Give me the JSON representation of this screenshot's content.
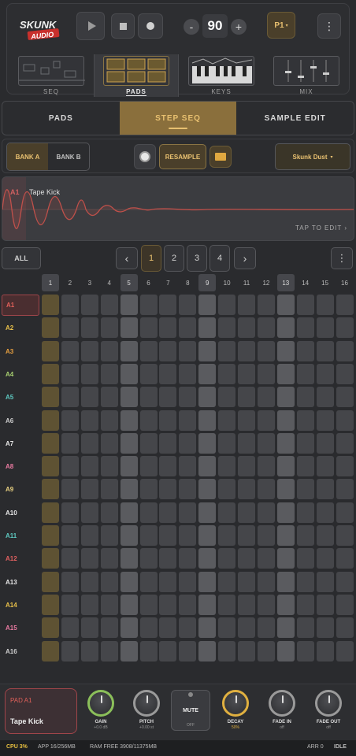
{
  "header": {
    "logo_text": "SKUNK AUDIO",
    "tempo": "90",
    "tempo_minus": "-",
    "tempo_plus": "+",
    "pattern": "P1",
    "modes": [
      {
        "label": "SEQ"
      },
      {
        "label": "PADS"
      },
      {
        "label": "KEYS"
      },
      {
        "label": "MIX"
      }
    ],
    "active_mode": "PADS"
  },
  "tabs": [
    {
      "label": "PADS"
    },
    {
      "label": "STEP SEQ"
    },
    {
      "label": "SAMPLE EDIT"
    }
  ],
  "active_tab": "STEP SEQ",
  "bank": {
    "a": "BANK A",
    "b": "BANK B",
    "resample": "RESAMPLE",
    "kit": "Skunk Dust"
  },
  "waveform": {
    "pad": "A1",
    "sample": "Tape Kick",
    "hint": "TAP TO EDIT ›"
  },
  "nav": {
    "all": "ALL",
    "prev": "‹",
    "next": "›",
    "pages": [
      "1",
      "2",
      "3",
      "4"
    ],
    "active_page": "1",
    "more": "⋮"
  },
  "grid": {
    "steps": [
      "1",
      "2",
      "3",
      "4",
      "5",
      "6",
      "7",
      "8",
      "9",
      "10",
      "11",
      "12",
      "13",
      "14",
      "15",
      "16"
    ],
    "rows": [
      {
        "label": "A1",
        "color": "#e0605a"
      },
      {
        "label": "A2",
        "color": "#e8c04a"
      },
      {
        "label": "A3",
        "color": "#e8a040"
      },
      {
        "label": "A4",
        "color": "#a8d070"
      },
      {
        "label": "A5",
        "color": "#5ec8c0"
      },
      {
        "label": "A6",
        "color": "#cfcfcf"
      },
      {
        "label": "A7",
        "color": "#e8e8e8"
      },
      {
        "label": "A8",
        "color": "#e87aa0"
      },
      {
        "label": "A9",
        "color": "#e8d080"
      },
      {
        "label": "A10",
        "color": "#e8e8e8"
      },
      {
        "label": "A11",
        "color": "#5ec8c0"
      },
      {
        "label": "A12",
        "color": "#e06060"
      },
      {
        "label": "A13",
        "color": "#e8e8e8"
      },
      {
        "label": "A14",
        "color": "#e8c04a"
      },
      {
        "label": "A15",
        "color": "#e87aa0"
      },
      {
        "label": "A16",
        "color": "#cfcfcf"
      }
    ]
  },
  "pad": {
    "title": "PAD A1",
    "sample": "Tape Kick"
  },
  "knobs": [
    {
      "label": "GAIN",
      "value": "+0.0 dB",
      "accent": "#8bbf5a"
    },
    {
      "label": "PITCH",
      "value": "+0.00 st",
      "accent": "#9a9a9a"
    },
    {
      "label": "MUTE",
      "value": "OFF",
      "accent": "#9a9a9a"
    },
    {
      "label": "DECAY",
      "value": "50%",
      "accent": "#e0b040"
    },
    {
      "label": "FADE IN",
      "value": "off",
      "accent": "#9a9a9a"
    },
    {
      "label": "FADE OUT",
      "value": "off",
      "accent": "#9a9a9a"
    }
  ],
  "status": {
    "cpu": "CPU 3%",
    "app": "APP 16/256MB",
    "ram": "RAM FREE 3908/11375MB",
    "arr": "ARR 0",
    "state": "IDLE"
  },
  "colors": {
    "accent": "#e8c070",
    "active_tab_bg": "#8a6f3c",
    "wave": "#c0504a"
  }
}
